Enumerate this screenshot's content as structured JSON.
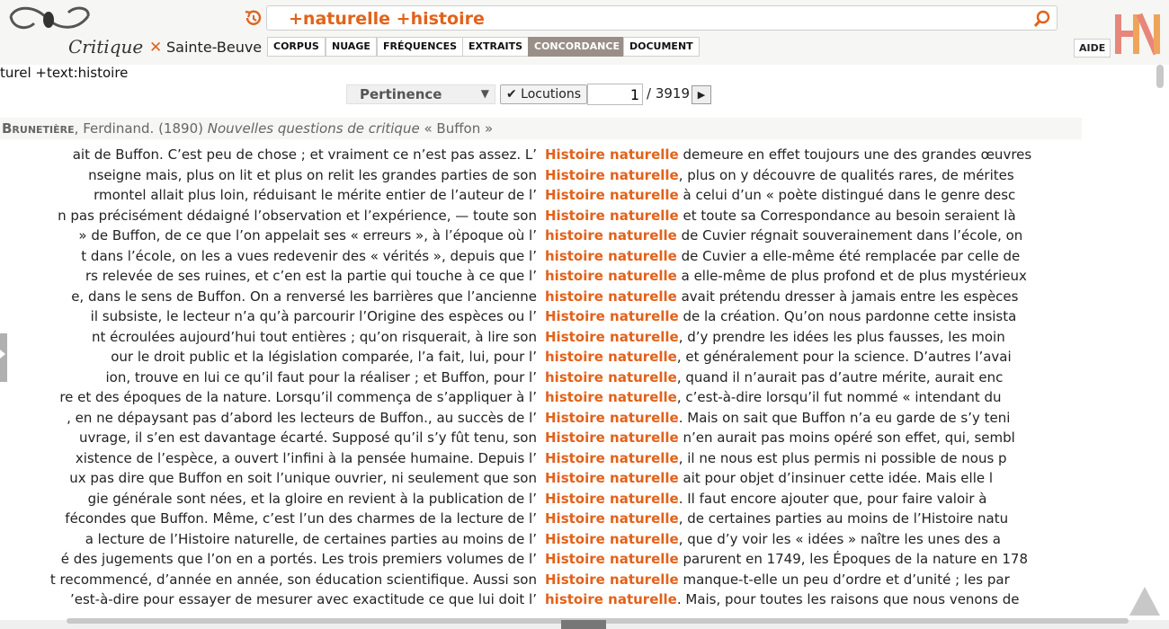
{
  "header": {
    "logo_text": "Critique",
    "corpus_name": "Sainte-Beuve",
    "search_query": "+naturelle +histoire",
    "tabs": [
      "CORPUS",
      "NUAGE",
      "FRÉQUENCES",
      "EXTRAITS",
      "CONCORDANCE",
      "DOCUMENT"
    ],
    "active_tab": "CONCORDANCE",
    "aide_label": "AIDE",
    "accent_color": "#e2621b"
  },
  "query_line": "turel +text:histoire",
  "controls": {
    "sort_label": "Pertinence",
    "locutions_label": "✔ Locutions",
    "page_value": "1",
    "page_total": "/ 3919"
  },
  "doc": {
    "author_last": "Brunetière",
    "author_rest": ", Ferdinand. (1890) ",
    "title": "Nouvelles questions de critique",
    "section": " « Buffon »"
  },
  "rows": [
    {
      "left": "ait de Buffon. C’est peu de chose ; et vraiment ce n’est pas assez. L’",
      "kw": "Histoire naturelle",
      "right": " demeure en effet toujours une des grandes œuvres"
    },
    {
      "left": "nseigne mais, plus on lit et plus on relit les grandes parties de son",
      "kw": "Histoire naturelle",
      "right": ", plus on y découvre de qualités rares, de mérites"
    },
    {
      "left": "rmontel allait plus loin, réduisant le mérite entier de l’auteur de l’",
      "kw": "Histoire naturelle",
      "right": " à celui d’un « poète distingué dans le genre desc"
    },
    {
      "left": "n pas précisément dédaigné l’observation et l’expérience, — toute son",
      "kw": "Histoire naturelle",
      "right": " et toute sa Correspondance au besoin seraient là"
    },
    {
      "left": "» de Buffon, de ce que l’on appelait ses « erreurs », à l’époque où l’",
      "kw": "histoire naturelle",
      "right": " de Cuvier régnait souverainement dans l’école, on"
    },
    {
      "left": "t dans l’école, on les a vues redevenir des « vérités », depuis que l’",
      "kw": "histoire naturelle",
      "right": " de Cuvier a elle-même été remplacée par celle de"
    },
    {
      "left": "rs relevée de ses ruines, et c’en est la partie qui touche à ce que l’",
      "kw": "histoire naturelle",
      "right": " a elle-même de plus profond et de plus mystérieux"
    },
    {
      "left": "e, dans le sens de Buffon. On a renversé les barrières que l’ancienne",
      "kw": "histoire naturelle",
      "right": " avait prétendu dresser à jamais entre les espèces"
    },
    {
      "left": "il subsiste, le lecteur n’a qu’à parcourir l’Origine des espèces ou l’",
      "kw": "Histoire naturelle",
      "right": " de la création. Qu’on nous pardonne cette insista"
    },
    {
      "left": "nt écroulées aujourd’hui tout entières ; qu’on risquerait, à lire son",
      "kw": "Histoire naturelle",
      "right": ", d’y prendre les idées les plus fausses, les moin"
    },
    {
      "left": "our le droit public et la législation comparée, l’a fait, lui, pour l’",
      "kw": "histoire naturelle",
      "right": ", et généralement pour la science. D’autres l’avai"
    },
    {
      "left": "ion, trouve en lui ce qu’il faut pour la réaliser ; et Buffon, pour l’",
      "kw": "histoire naturelle",
      "right": ", quand il n’aurait pas d’autre mérite, aurait enc"
    },
    {
      "left": "re et des époques de la nature. Lorsqu’il commença de s’appliquer à l’",
      "kw": "histoire naturelle",
      "right": ", c’est-à-dire lorsqu’il fut nommé « intendant du"
    },
    {
      "left": ", en ne dépaysant pas d’abord les lecteurs de Buffon., au succès de l’",
      "kw": "Histoire naturelle",
      "right": ". Mais on sait que Buffon n’a eu garde de s’y teni"
    },
    {
      "left": "uvrage, il s’en est davantage écarté. Supposé qu’il s’y fût tenu, son",
      "kw": "Histoire naturelle",
      "right": " n’en aurait pas moins opéré son effet, qui, sembl"
    },
    {
      "left": "xistence de l’espèce, a ouvert l’infini à la pensée humaine. Depuis l’",
      "kw": "Histoire naturelle",
      "right": ", il ne nous est plus permis ni possible de nous p"
    },
    {
      "left": "ux pas dire que Buffon en soit l’unique ouvrier, ni seulement que son",
      "kw": "Histoire naturelle",
      "right": " ait pour objet d’insinuer cette idée. Mais elle l"
    },
    {
      "left": "gie générale sont nées, et la gloire en revient à la publication de l’",
      "kw": "Histoire naturelle",
      "right": ". Il faut encore ajouter que, pour faire valoir à"
    },
    {
      "left": "fécondes que Buffon. Même, c’est l’un des charmes de la lecture de l’",
      "kw": "Histoire naturelle",
      "right": ", de certaines parties au moins de l’Histoire natu"
    },
    {
      "left": "a lecture de l’Histoire naturelle, de certaines parties au moins de l’",
      "kw": "Histoire naturelle",
      "right": ", que d’y voir les « idées » naître les unes des a"
    },
    {
      "left": "é des jugements que l’on en a portés. Les trois premiers volumes de l’",
      "kw": "Histoire naturelle",
      "right": " parurent en 1749, les Époques de la nature en 178"
    },
    {
      "left": "t recommencé, d’année en année, son éducation scientifique. Aussi son",
      "kw": "Histoire naturelle",
      "right": " manque-t-elle un peu d’ordre et d’unité ; les par"
    },
    {
      "left": "’est-à-dire pour essayer de mesurer avec exactitude ce que lui doit l’",
      "kw": "histoire naturelle",
      "right": ". Mais, pour toutes les raisons que nous venons de"
    }
  ]
}
